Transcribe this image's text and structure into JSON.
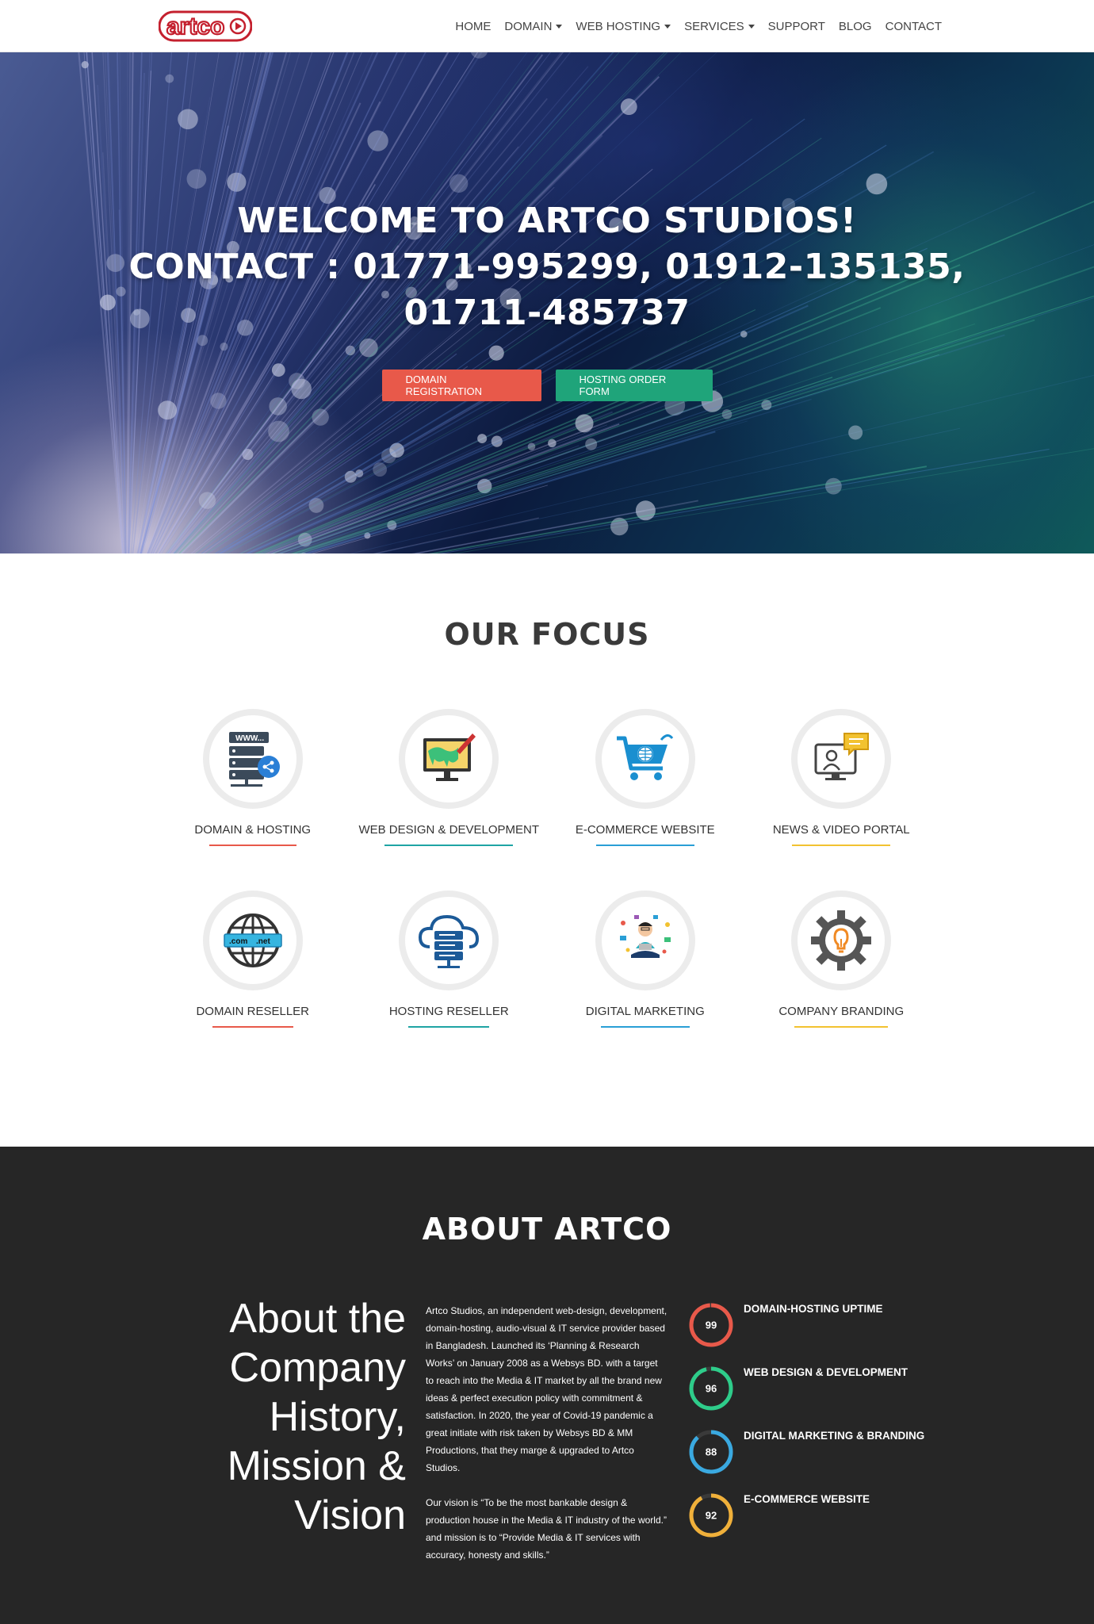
{
  "nav": {
    "logo_text": "artco",
    "items": [
      {
        "label": "HOME",
        "dropdown": false
      },
      {
        "label": "DOMAIN",
        "dropdown": true
      },
      {
        "label": "WEB HOSTING",
        "dropdown": true
      },
      {
        "label": "SERVICES",
        "dropdown": true
      },
      {
        "label": "SUPPORT",
        "dropdown": false
      },
      {
        "label": "BLOG",
        "dropdown": false
      },
      {
        "label": "CONTACT",
        "dropdown": false
      }
    ]
  },
  "hero": {
    "line1": "WELCOME TO ARTCO STUDIOS!",
    "line2": "CONTACT : 01771-995299, 01912-135135,",
    "line3": "01711-485737",
    "btn_domain": "DOMAIN REGISTRATION",
    "btn_hosting": "HOSTING ORDER FORM"
  },
  "focus": {
    "title": "OUR FOCUS",
    "items": [
      {
        "label": "DOMAIN & HOSTING",
        "icon": "server-icon",
        "accent": "#e8594a"
      },
      {
        "label": "WEB DESIGN & DEVELOPMENT",
        "icon": "monitor-paint-icon",
        "accent": "#1fa4a4"
      },
      {
        "label": "E-COMMERCE WEBSITE",
        "icon": "shopping-cart-globe-icon",
        "accent": "#2a9fd6"
      },
      {
        "label": "NEWS & VIDEO PORTAL",
        "icon": "video-chat-icon",
        "accent": "#f2c230"
      },
      {
        "label": "DOMAIN RESELLER",
        "icon": "globe-domain-icon",
        "accent": "#e8594a"
      },
      {
        "label": "HOSTING RESELLER",
        "icon": "cloud-server-icon",
        "accent": "#1fa4a4"
      },
      {
        "label": "DIGITAL MARKETING",
        "icon": "marketing-person-icon",
        "accent": "#2a9fd6"
      },
      {
        "label": "COMPANY BRANDING",
        "icon": "gear-bulb-icon",
        "accent": "#f2c230"
      }
    ]
  },
  "about": {
    "title": "ABOUT ARTCO",
    "lead": [
      "About the",
      "Company",
      "History,",
      "Mission &",
      "Vision"
    ],
    "paragraph1": "Artco Studios, an independent web-design, development, domain-hosting, audio-visual & IT service provider based in Bangladesh. Launched its ‘Planning & Research Works’ on January 2008 as a Websys BD. with a target to reach into the Media & IT market by all the brand new ideas & perfect execution policy with commitment & satisfaction. In 2020, the year of Covid-19 pandemic a great initiate with risk taken by Websys BD & MM Productions, that they marge & upgraded to Artco Studios.",
    "paragraph2": "Our vision is “To be the most bankable design & production house in the Media & IT industry of the world.” and mission is to “Provide Media & IT services with accuracy, honesty and skills.”",
    "stats": [
      {
        "label": "DOMAIN-HOSTING UPTIME",
        "value": 99,
        "color": "#e8594a"
      },
      {
        "label": "WEB DESIGN & DEVELOPMENT",
        "value": 96,
        "color": "#2ecc8a"
      },
      {
        "label": "DIGITAL MARKETING & BRANDING",
        "value": 88,
        "color": "#3aa9e0"
      },
      {
        "label": "E-COMMERCE WEBSITE",
        "value": 92,
        "color": "#f0b03a"
      }
    ]
  }
}
